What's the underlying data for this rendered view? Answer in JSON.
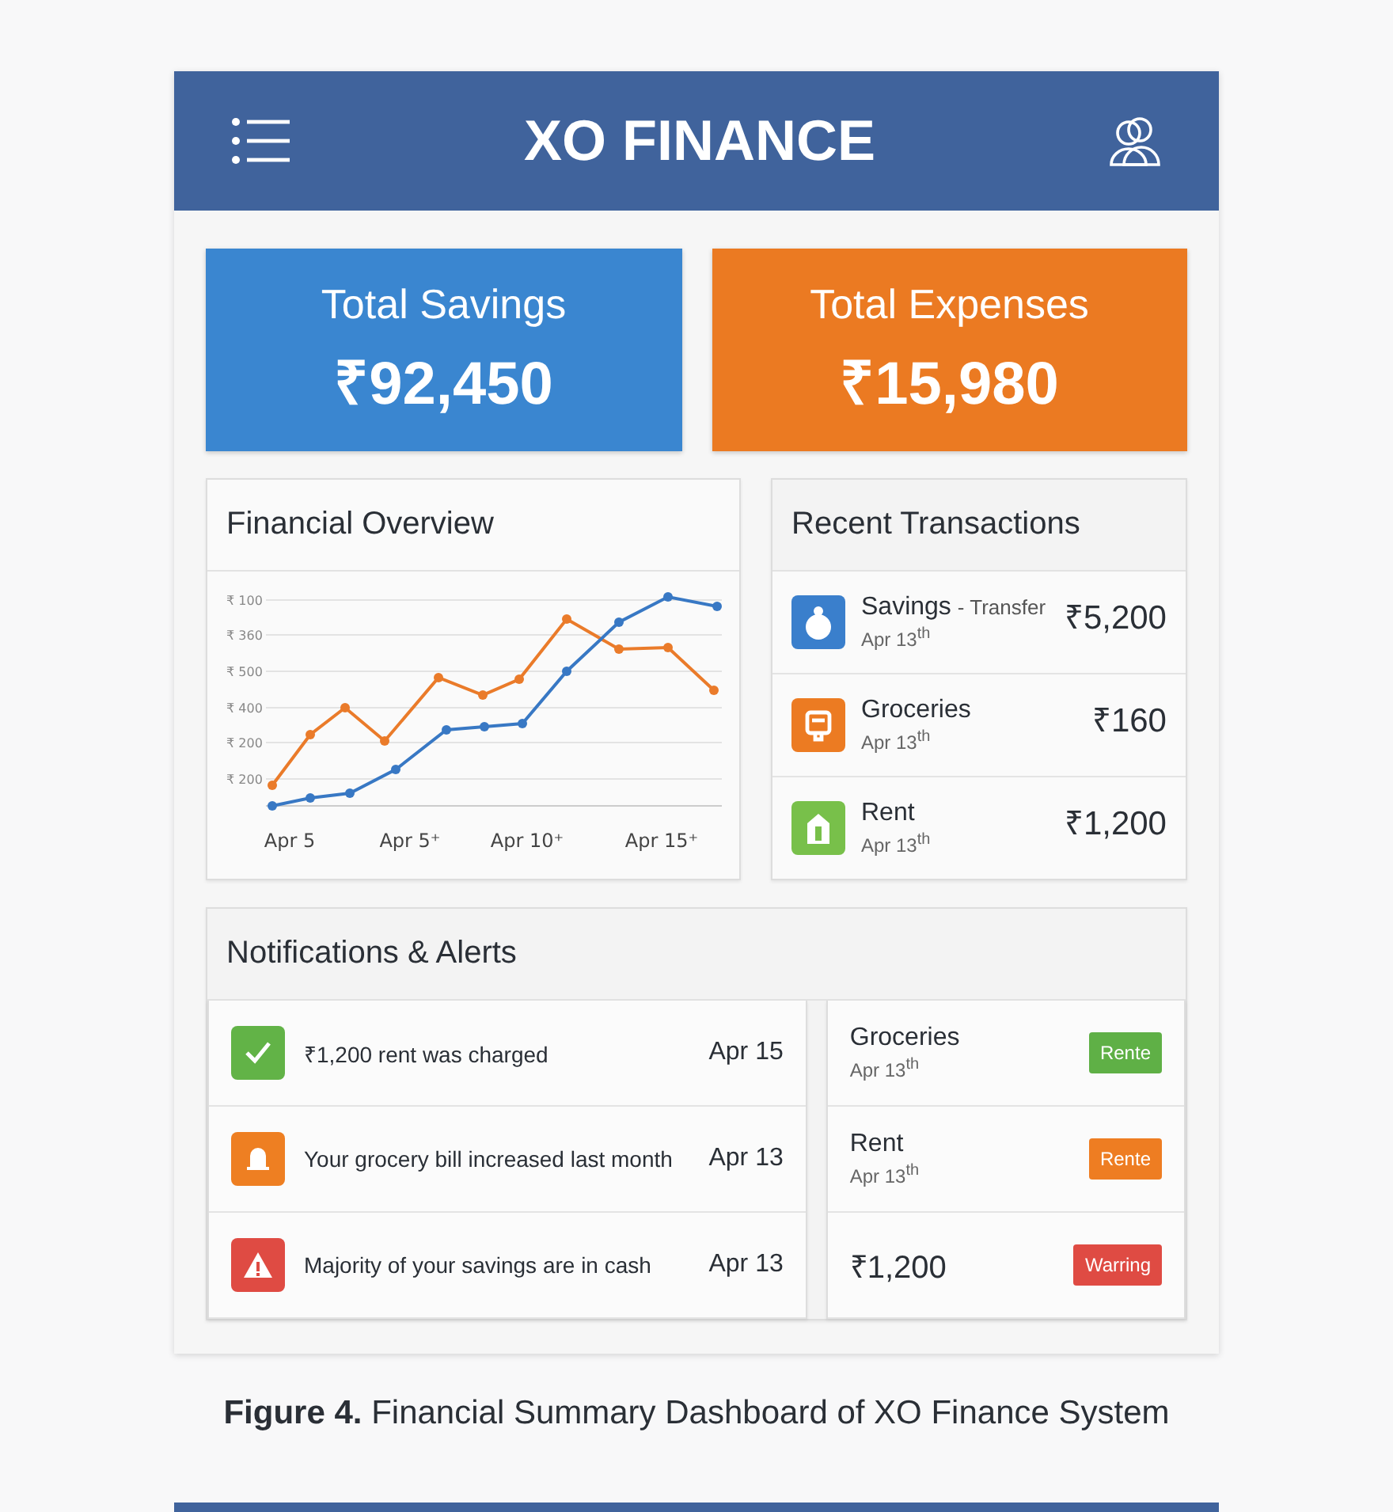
{
  "header": {
    "title": "XO FINANCE"
  },
  "summary_cards": [
    {
      "label": "Total Savings",
      "amount": "₹92,450",
      "color": "#3a86d0"
    },
    {
      "label": "Total Expenses",
      "amount": "₹15,980",
      "color": "#eb7a22"
    }
  ],
  "financial_overview": {
    "title": "Financial Overview",
    "y_labels": [
      "₹ 100",
      "₹ 360",
      "₹ 500",
      "₹ 400",
      "₹ 200",
      "₹ 200"
    ],
    "x_labels": [
      "Apr 5",
      "Apr 5⁺",
      "Apr 10⁺",
      "Apr 15⁺"
    ]
  },
  "recent_transactions": {
    "title": "Recent Transactions",
    "items": [
      {
        "kind": "savings",
        "name": "Savings",
        "detail": "- Transfer",
        "date": "Apr 13$^{th}$",
        "amount": "₹5,200"
      },
      {
        "kind": "groceries",
        "name": "Groceries",
        "date": "Apr 13$^{th}$",
        "amount": "₹160"
      },
      {
        "kind": "rent",
        "name": "Rent",
        "date": "Apr 13$^{th}$",
        "amount": "₹1,200"
      }
    ]
  },
  "notifications": {
    "title": "Notifications & Alerts",
    "alerts": [
      {
        "kind": "success",
        "text": "₹1,200 rent was charged",
        "date": "Apr 15"
      },
      {
        "kind": "reminder",
        "text": "Your grocery bill increased last month",
        "date": "Apr 13"
      },
      {
        "kind": "warning",
        "text": "Majority of your savings are in cash",
        "date": "Apr 13"
      }
    ],
    "items": [
      {
        "name": "Groceries",
        "date": "Apr 13$^{th}$",
        "badge": "Rente",
        "color": "#5fb046"
      },
      {
        "name": "Rent",
        "date": "Apr 13$^{th}$",
        "badge": "Rente",
        "color": "#ee7d22"
      },
      {
        "name": "₹1,200",
        "badge": "Warring",
        "color": "#df4b43"
      }
    ]
  },
  "caption": {
    "label": "Figure 4.",
    "text": "Financial Summary Dashboard of XO Finance System"
  }
}
